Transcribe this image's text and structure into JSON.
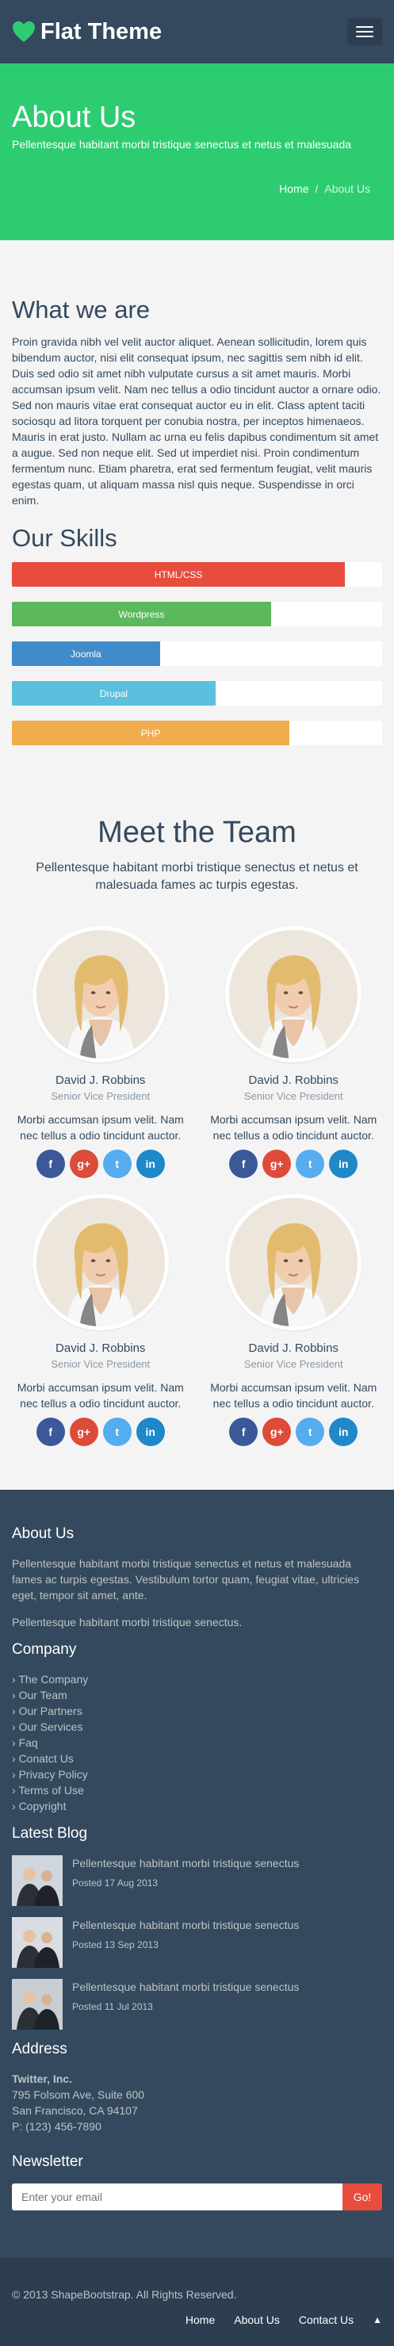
{
  "navbar": {
    "brand": "Flat Theme"
  },
  "banner": {
    "title": "About Us",
    "subtitle": "Pellentesque habitant morbi tristique senectus et netus et malesuada",
    "breadcrumb": {
      "home": "Home",
      "current": "About Us"
    }
  },
  "about": {
    "heading": "What we are",
    "body": "Proin gravida nibh vel velit auctor aliquet. Aenean sollicitudin, lorem quis bibendum auctor, nisi elit consequat ipsum, nec sagittis sem nibh id elit. Duis sed odio sit amet nibh vulputate cursus a sit amet mauris. Morbi accumsan ipsum velit. Nam nec tellus a odio tincidunt auctor a ornare odio. Sed non mauris vitae erat consequat auctor eu in elit. Class aptent taciti sociosqu ad litora torquent per conubia nostra, per inceptos himenaeos. Mauris in erat justo. Nullam ac urna eu felis dapibus condimentum sit amet a augue. Sed non neque elit. Sed ut imperdiet nisi. Proin condimentum fermentum nunc. Etiam pharetra, erat sed fermentum feugiat, velit mauris egestas quam, ut aliquam massa nisl quis neque. Suspendisse in orci enim."
  },
  "skills": {
    "heading": "Our Skills",
    "items": [
      {
        "label": "HTML/CSS",
        "level": 0.9,
        "color": "#e74c3c"
      },
      {
        "label": "Wordpress",
        "level": 0.7,
        "color": "#5cb85c"
      },
      {
        "label": "Joomla",
        "level": 0.4,
        "color": "#428bca"
      },
      {
        "label": "Drupal",
        "level": 0.55,
        "color": "#5bc0de"
      },
      {
        "label": "PHP",
        "level": 0.75,
        "color": "#f0ad4e"
      }
    ]
  },
  "team": {
    "heading": "Meet the Team",
    "lead": "Pellentesque habitant morbi tristique senectus et netus et malesuada fames ac turpis egestas.",
    "members": [
      {
        "name": "David J. Robbins",
        "role": "Senior Vice President",
        "desc": "Morbi accumsan ipsum velit. Nam nec tellus a odio tincidunt auctor."
      },
      {
        "name": "David J. Robbins",
        "role": "Senior Vice President",
        "desc": "Morbi accumsan ipsum velit. Nam nec tellus a odio tincidunt auctor."
      },
      {
        "name": "David J. Robbins",
        "role": "Senior Vice President",
        "desc": "Morbi accumsan ipsum velit. Nam nec tellus a odio tincidunt auctor."
      },
      {
        "name": "David J. Robbins",
        "role": "Senior Vice President",
        "desc": "Morbi accumsan ipsum velit. Nam nec tellus a odio tincidunt auctor."
      }
    ],
    "social": {
      "facebook": {
        "glyph": "f",
        "color": "#3b5998"
      },
      "google": {
        "glyph": "g+",
        "color": "#dd4b39"
      },
      "twitter": {
        "glyph": "t",
        "color": "#55acee"
      },
      "linkedin": {
        "glyph": "in",
        "color": "#1e88c8"
      }
    }
  },
  "bottom": {
    "about": {
      "heading": "About Us",
      "p1": "Pellentesque habitant morbi tristique senectus et netus et malesuada fames ac turpis egestas. Vestibulum tortor quam, feugiat vitae, ultricies eget, tempor sit amet, ante.",
      "p2": "Pellentesque habitant morbi tristique senectus."
    },
    "company": {
      "heading": "Company",
      "links": [
        "The Company",
        "Our Team",
        "Our Partners",
        "Our Services",
        "Faq",
        "Conatct Us",
        "Privacy Policy",
        "Terms of Use",
        "Copyright"
      ]
    },
    "blog": {
      "heading": "Latest Blog",
      "posts": [
        {
          "title": "Pellentesque habitant morbi tristique senectus",
          "date": "Posted 17 Aug 2013"
        },
        {
          "title": "Pellentesque habitant morbi tristique senectus",
          "date": "Posted 13 Sep 2013"
        },
        {
          "title": "Pellentesque habitant morbi tristique senectus",
          "date": "Posted 11 Jul 2013"
        }
      ]
    },
    "address": {
      "heading": "Address",
      "company": "Twitter, Inc.",
      "line1": "795 Folsom Ave, Suite 600",
      "line2": "San Francisco, CA 94107",
      "phone": "P: (123) 456-7890"
    },
    "newsletter": {
      "heading": "Newsletter",
      "placeholder": "Enter your email",
      "button": "Go!"
    }
  },
  "footer": {
    "copyright": "© 2013 ShapeBootstrap. All Rights Reserved.",
    "nav": [
      "Home",
      "About Us",
      "Contact Us"
    ]
  }
}
